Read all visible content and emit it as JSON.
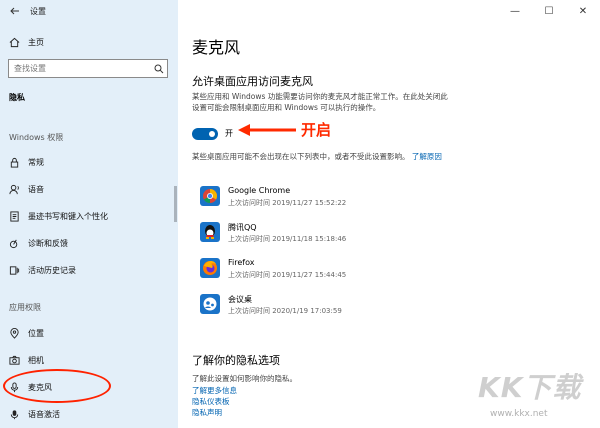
{
  "window": {
    "title": "设置"
  },
  "sidebar": {
    "home": "主页",
    "search_placeholder": "查找设置",
    "privacy": "隐私",
    "windows_section": "Windows 权限",
    "windows_items": [
      "常规",
      "语音",
      "墨迹书写和键入个性化",
      "诊断和反馈",
      "活动历史记录"
    ],
    "app_section": "应用权限",
    "app_items": [
      "位置",
      "相机",
      "麦克风",
      "语音激活"
    ]
  },
  "main": {
    "title": "麦克风",
    "section_title": "允许桌面应用访问麦克风",
    "description_line1": "某些应用和 Windows 功能需要访问你的麦克风才能正常工作。在此处关闭此",
    "description_line2": "设置可能会限制桌面应用和 Windows 可以执行的操作。",
    "toggle_state": "开",
    "toggle_on": true,
    "annotation": "开启",
    "note_text": "某些桌面应用可能不会出现在以下列表中，或者不受此设置影响。",
    "note_link": "了解原因",
    "apps": [
      {
        "name": "Google Chrome",
        "last_access": "上次访问时间 2019/11/27 15:52:22"
      },
      {
        "name": "腾讯QQ",
        "last_access": "上次访问时间 2019/11/18 15:18:46"
      },
      {
        "name": "Firefox",
        "last_access": "上次访问时间 2019/11/27 15:44:45"
      },
      {
        "name": "会议桌",
        "last_access": "上次访问时间 2020/1/19 17:03:59"
      }
    ],
    "privacy_title": "了解你的隐私选项",
    "privacy_desc": "了解此设置如何影响你的隐私。",
    "privacy_links": [
      "了解更多信息",
      "隐私仪表板",
      "隐私声明"
    ]
  },
  "watermark": {
    "big": "KK下载",
    "small": "www.kkx.net"
  },
  "colors": {
    "accent": "#0063b1",
    "annotation": "#ff2a00",
    "sidebar_bg": "#e3eff9"
  }
}
